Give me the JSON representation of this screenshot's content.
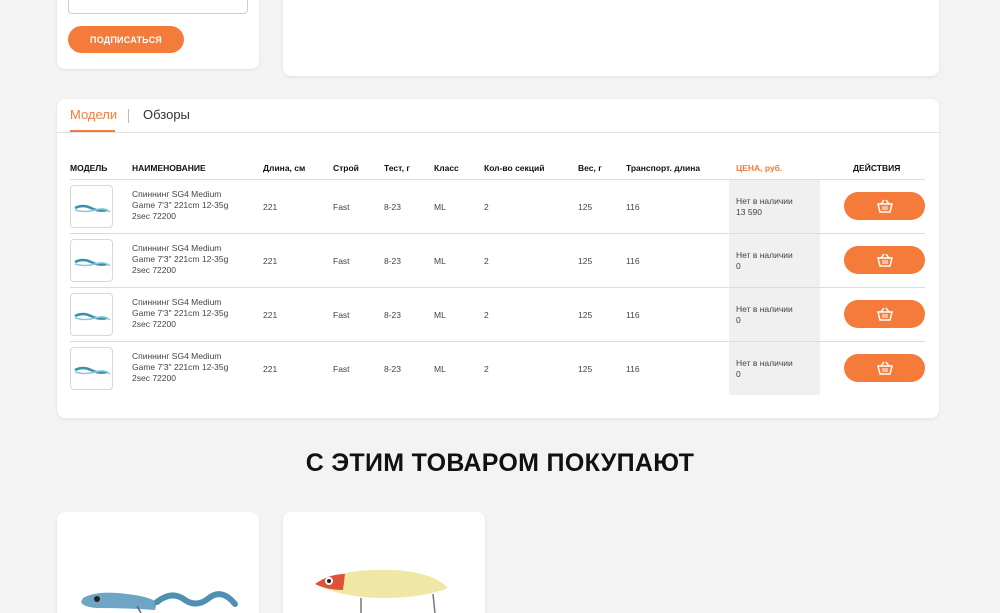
{
  "subscribe": {
    "button_label": "ПОДПИСАТЬСЯ"
  },
  "tabs": [
    {
      "label": "Модели",
      "active": true
    },
    {
      "label": "Обзоры",
      "active": false
    }
  ],
  "table": {
    "headers": {
      "model": "МОДЕЛЬ",
      "name": "НАИМЕНОВАНИЕ",
      "length": "Длина, см",
      "action": "Строй",
      "test": "Тест, г",
      "class": "Класс",
      "sections": "Кол-во секций",
      "weight": "Вес, г",
      "transport": "Транспорт. длина",
      "price": "ЦЕНА, руб.",
      "actions": "ДЕЙСТВИЯ"
    },
    "rows": [
      {
        "name": "Спиннинг SG4 Medium Game 7'3\" 221cm 12-35g 2sec 72200",
        "length": "221",
        "action": "Fast",
        "test": "8-23",
        "class": "ML",
        "sections": "2",
        "weight": "125",
        "transport": "116",
        "availability": "Нет в наличии",
        "price": "13 590"
      },
      {
        "name": "Спиннинг SG4 Medium Game 7'3\" 221cm 12-35g 2sec 72200",
        "length": "221",
        "action": "Fast",
        "test": "8-23",
        "class": "ML",
        "sections": "2",
        "weight": "125",
        "transport": "116",
        "availability": "Нет в наличии",
        "price": "0"
      },
      {
        "name": "Спиннинг SG4 Medium Game 7'3\" 221cm 12-35g 2sec 72200",
        "length": "221",
        "action": "Fast",
        "test": "8-23",
        "class": "ML",
        "sections": "2",
        "weight": "125",
        "transport": "116",
        "availability": "Нет в наличии",
        "price": "0"
      },
      {
        "name": "Спиннинг SG4 Medium Game 7'3\" 221cm 12-35g 2sec 72200",
        "length": "221",
        "action": "Fast",
        "test": "8-23",
        "class": "ML",
        "sections": "2",
        "weight": "125",
        "transport": "116",
        "availability": "Нет в наличии",
        "price": "0"
      }
    ],
    "cart_icon": "basket-icon"
  },
  "related": {
    "title": "С ЭТИМ ТОВАРОМ ПОКУПАЮТ",
    "products": [
      {
        "image": "soft-bait-fish-image"
      },
      {
        "image": "wobbler-lure-image"
      }
    ]
  },
  "colors": {
    "accent": "#f47b3a",
    "background": "#f3f3f3"
  }
}
